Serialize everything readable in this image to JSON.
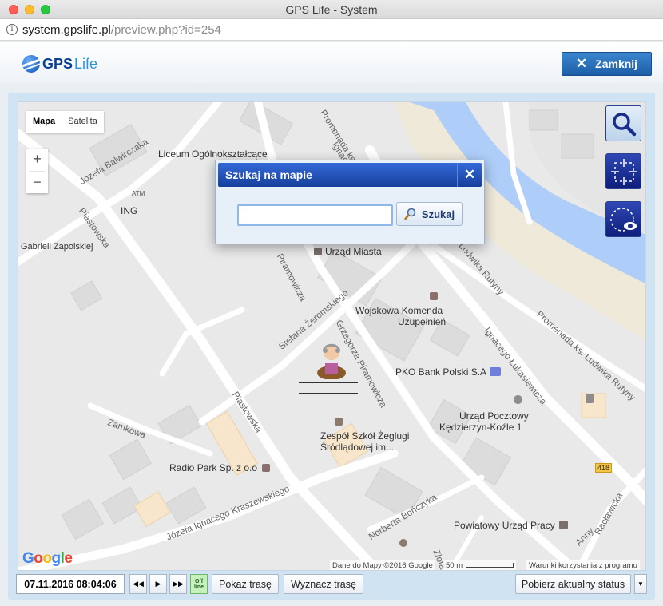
{
  "window": {
    "title": "GPS Life - System"
  },
  "address": {
    "host": "system.gpslife.pl",
    "path": "/preview.php?id=254"
  },
  "header": {
    "logo_gps": "GPS",
    "logo_life": "Life",
    "close_label": "Zamknij"
  },
  "map": {
    "type_buttons": [
      "Mapa",
      "Satelita"
    ],
    "zoom_in": "+",
    "zoom_out": "−",
    "pois": {
      "liceum": "Liceum Ogólnokształcące",
      "atm": "ATM",
      "ing": "ING",
      "urzad_miasta": "Urząd Miasta",
      "wojskowa_1": "Wojskowa Komenda",
      "wojskowa_2": "Uzupełnień",
      "pko": "PKO Bank Polski S.A",
      "poczta_1": "Urząd Pocztowy",
      "poczta_2": "Kędzierzyn-Koźle 1",
      "szkola_1": "Zespół Szkół Żeglugi",
      "szkola_2": "Śródlądowej im...",
      "radio": "Radio Park Sp. z o.o",
      "powiatowy": "Powiatowy Urząd Pracy",
      "road_418": "418"
    },
    "streets": {
      "balwirczaka": "Józefa Balwirczaka",
      "zapolskiej": "Gabrieli Zapolskiej",
      "piastowska1": "Piastowska",
      "piastowska2": "Piastowska",
      "zeromskiego": "Stefana Żeromskiego",
      "piramowicza1": "Grzegorza Piramowicza",
      "piramowicza2": "Piramowicza",
      "promenada1": "Promenada ks. Ludwika",
      "promenada2": "Promenada ks. Ludwika Rutyny",
      "rutyny": "Ludwika Rutyny",
      "lukasiewicza": "Ignacego Łukasiewicza",
      "zamkowa": "Zamkowa",
      "kraszewskiego": "Józefa Ignacego Kraszewskiego",
      "bonczyka": "Norberta Bończyka",
      "raclawicka": "Racławicka",
      "anny": "Anny",
      "zlota": "Złota",
      "ignace": "Ignac"
    },
    "attribution": "Dane do Mapy ©2016 Google",
    "scale": "50 m",
    "terms": "Warunki korzystania z programu",
    "google_letters": [
      "G",
      "o",
      "o",
      "g",
      "l",
      "e"
    ]
  },
  "search_dialog": {
    "title": "Szukaj na mapie",
    "close": "✕",
    "input_value": "",
    "button_label": "Szukaj"
  },
  "bottom": {
    "datetime": "07.11.2016 08:04:06",
    "offline_label": "Off line",
    "show_route": "Pokaż trasę",
    "set_route": "Wyznacz trasę",
    "get_status": "Pobierz aktualny status"
  },
  "colors": {
    "accent": "#1d5ea8",
    "dialog_header": "#2553c0",
    "water": "#aecdf8",
    "map_bg": "#e9e9e9"
  }
}
